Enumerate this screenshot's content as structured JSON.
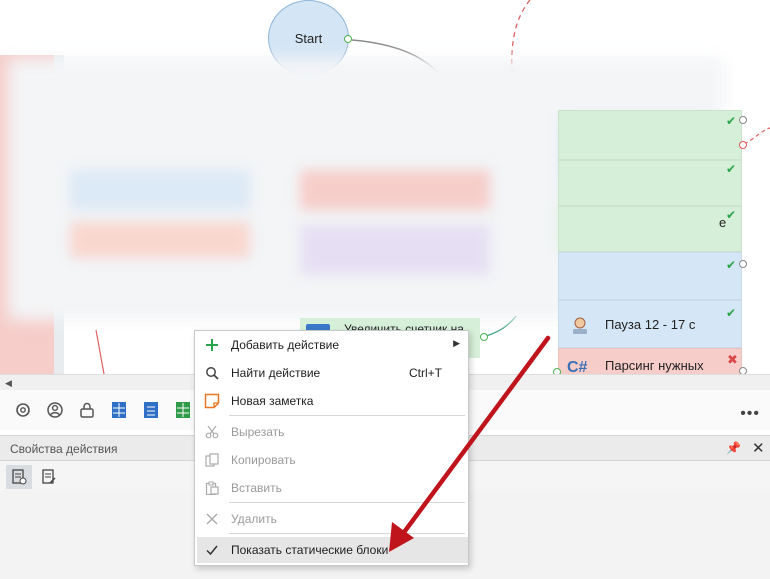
{
  "canvas": {
    "start_label": "Start",
    "partial_node_1": "Увеличить счетчик на",
    "right_blocks": [
      {
        "label": "",
        "color": "green"
      },
      {
        "label": "",
        "color": "green"
      },
      {
        "label": "e",
        "color": "green"
      },
      {
        "label": "",
        "color": "blue"
      },
      {
        "label": "Пауза 12 - 17 с",
        "color": "blue"
      },
      {
        "label": "Парсинг нужных",
        "color": "red"
      }
    ]
  },
  "properties": {
    "title": "Свойства действия"
  },
  "context_menu": {
    "items": [
      {
        "label": "Добавить действие",
        "shortcut": "",
        "has_submenu": true,
        "enabled": true
      },
      {
        "label": "Найти действие",
        "shortcut": "Ctrl+T",
        "has_submenu": false,
        "enabled": true
      },
      {
        "label": "Новая заметка",
        "shortcut": "",
        "has_submenu": false,
        "enabled": true
      },
      {
        "label": "Вырезать",
        "shortcut": "",
        "has_submenu": false,
        "enabled": false
      },
      {
        "label": "Копировать",
        "shortcut": "",
        "has_submenu": false,
        "enabled": false
      },
      {
        "label": "Вставить",
        "shortcut": "",
        "has_submenu": false,
        "enabled": false
      },
      {
        "label": "Удалить",
        "shortcut": "",
        "has_submenu": false,
        "enabled": false
      },
      {
        "label": "Показать статические блоки",
        "shortcut": "",
        "has_submenu": false,
        "enabled": true,
        "checked": true
      }
    ]
  },
  "colors": {
    "accent_green": "#2aa34a",
    "annotation_arrow": "#c0141c",
    "block_red": "#f6cdc9",
    "block_green": "#d6efd9",
    "block_blue": "#d5e7f7"
  }
}
